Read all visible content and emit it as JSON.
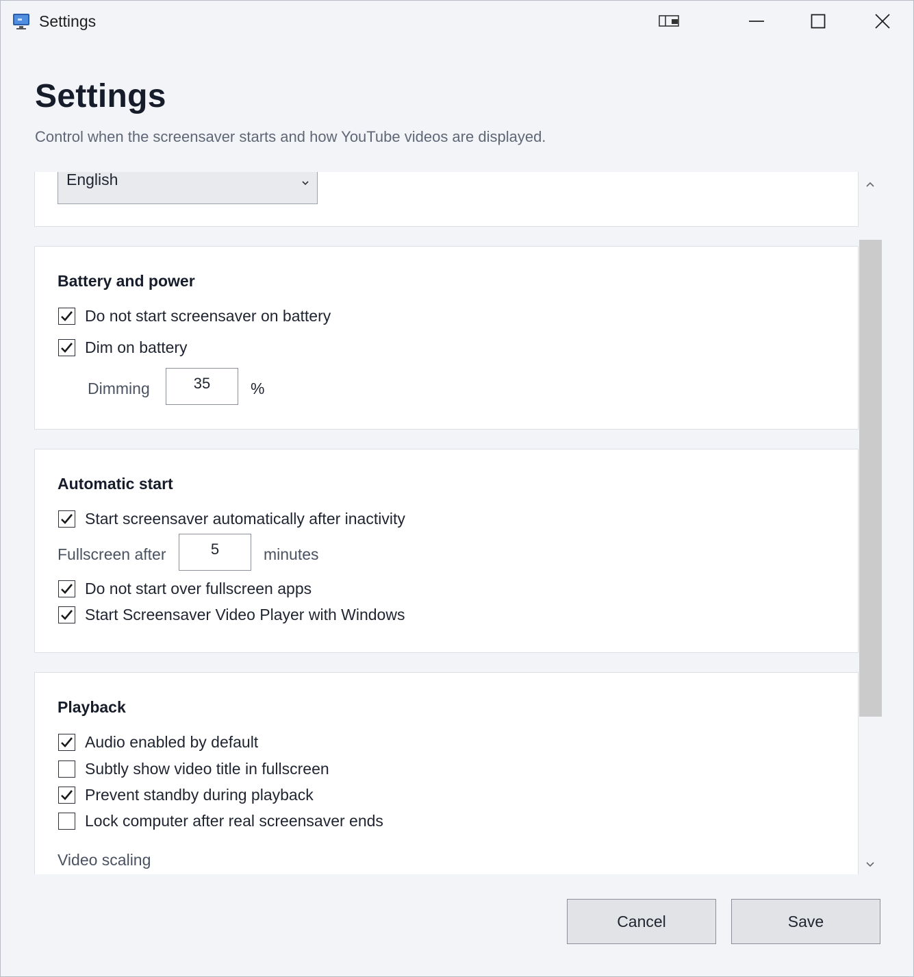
{
  "window": {
    "title": "Settings",
    "icons": {
      "app": "monitor-app-icon",
      "snap": "snap-layout-icon",
      "minimize": "minimize-icon",
      "maximize": "maximize-icon",
      "close": "close-icon"
    }
  },
  "header": {
    "title": "Settings",
    "subtitle": "Control when the screensaver starts and how YouTube videos are displayed."
  },
  "language": {
    "selected": "English"
  },
  "battery": {
    "title": "Battery and power",
    "no_start_on_battery": {
      "label": "Do not start screensaver on battery",
      "checked": true
    },
    "dim_on_battery": {
      "label": "Dim on battery",
      "checked": true
    },
    "dimming_label": "Dimming",
    "dimming_value": "35",
    "dimming_unit": "%"
  },
  "auto_start": {
    "title": "Automatic start",
    "start_after_inactivity": {
      "label": "Start screensaver automatically after inactivity",
      "checked": true
    },
    "fullscreen_label": "Fullscreen after",
    "fullscreen_value": "5",
    "fullscreen_unit": "minutes",
    "no_start_over_fullscreen": {
      "label": "Do not start over fullscreen apps",
      "checked": true
    },
    "start_with_windows": {
      "label": "Start Screensaver Video Player with Windows",
      "checked": true
    }
  },
  "playback": {
    "title": "Playback",
    "audio_enabled": {
      "label": "Audio enabled by default",
      "checked": true
    },
    "show_title": {
      "label": "Subtly show video title in fullscreen",
      "checked": false
    },
    "prevent_standby": {
      "label": "Prevent standby during playback",
      "checked": true
    },
    "lock_computer": {
      "label": "Lock computer after real screensaver ends",
      "checked": false
    },
    "video_scaling_label": "Video scaling"
  },
  "footer": {
    "cancel": "Cancel",
    "save": "Save"
  },
  "colors": {
    "background": "#f3f4f7",
    "card": "#ffffff",
    "border": "#dcdfe5",
    "scroll_thumb": "#cbcbcb",
    "button": "#e2e3e6"
  }
}
